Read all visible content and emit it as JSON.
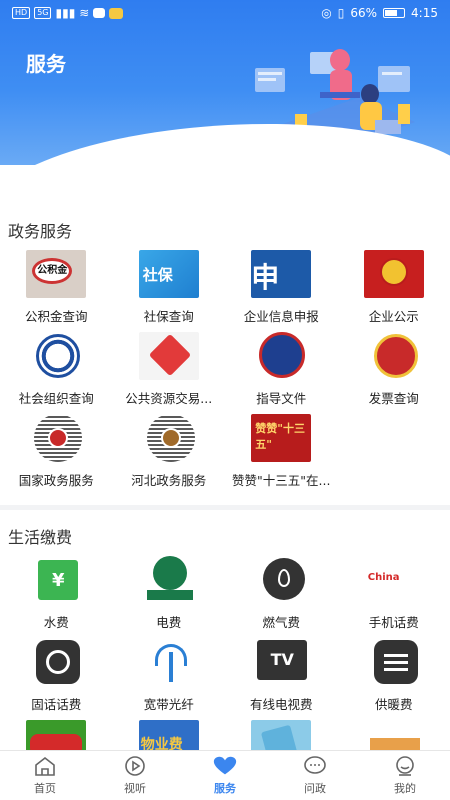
{
  "status_bar": {
    "left_chip_1": "HD",
    "left_chip_2": "5G",
    "battery_pct": "66%",
    "time": "4:15"
  },
  "header": {
    "title": "服务"
  },
  "sections": [
    {
      "title": "政务服务",
      "items": [
        {
          "label": "公积金查询",
          "art": "公积金"
        },
        {
          "label": "社保查询",
          "art": "社保"
        },
        {
          "label": "企业信息申报",
          "art": "申报"
        },
        {
          "label": "企业公示"
        },
        {
          "label": "社会组织查询"
        },
        {
          "label": "公共资源交易..."
        },
        {
          "label": "指导文件"
        },
        {
          "label": "发票查询"
        },
        {
          "label": "国家政务服务"
        },
        {
          "label": "河北政务服务"
        },
        {
          "label": "赞赞\"十三五\"在...",
          "art": "赞赞\"十三五\""
        }
      ]
    },
    {
      "title": "生活缴费",
      "items": [
        {
          "label": "水费",
          "art": "¥"
        },
        {
          "label": "电费"
        },
        {
          "label": "燃气费"
        },
        {
          "label": "手机话费",
          "art": "China"
        },
        {
          "label": "固话话费"
        },
        {
          "label": "宽带光纤"
        },
        {
          "label": "有线电视费",
          "art": "TV"
        },
        {
          "label": "供暖费"
        },
        {
          "label": ""
        },
        {
          "label": "",
          "art": "物业费"
        },
        {
          "label": ""
        },
        {
          "label": ""
        }
      ]
    }
  ],
  "bottom_nav": [
    {
      "label": "首页",
      "icon": "home-icon"
    },
    {
      "label": "视听",
      "icon": "play-icon"
    },
    {
      "label": "服务",
      "icon": "heart-icon",
      "active": true
    },
    {
      "label": "问政",
      "icon": "chat-icon"
    },
    {
      "label": "我的",
      "icon": "profile-icon"
    }
  ],
  "colors": {
    "accent": "#3b86ef",
    "hero": "#2f7df0"
  }
}
